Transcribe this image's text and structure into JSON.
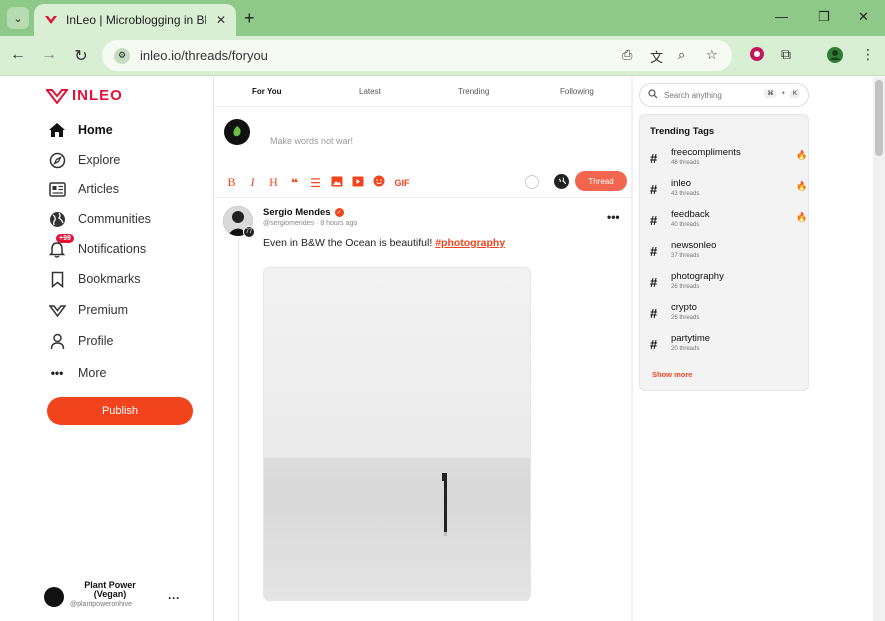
{
  "browser": {
    "tab_title": "InLeo | Microblogging in Blockc",
    "url": "inleo.io/threads/foryou",
    "accent": "#8fc98a"
  },
  "sidebar": {
    "logo_text": "INLEO",
    "items": [
      {
        "label": "Home",
        "icon": "home-icon",
        "active": true
      },
      {
        "label": "Explore",
        "icon": "compass-icon"
      },
      {
        "label": "Articles",
        "icon": "articles-icon"
      },
      {
        "label": "Communities",
        "icon": "globe-icon"
      },
      {
        "label": "Notifications",
        "icon": "bell-icon",
        "badge": "+99"
      },
      {
        "label": "Bookmarks",
        "icon": "bookmark-icon"
      },
      {
        "label": "Premium",
        "icon": "leo-icon"
      },
      {
        "label": "Profile",
        "icon": "user-icon"
      },
      {
        "label": "More",
        "icon": "dots-icon"
      }
    ],
    "publish_label": "Publish",
    "profile": {
      "name": "Plant Power (Vegan)",
      "handle": "@plantpoweronhive"
    }
  },
  "feed": {
    "tabs": [
      "For You",
      "Latest",
      "Trending",
      "Following"
    ],
    "composer_placeholder": "Make words not war!",
    "gif_label": "GIF",
    "thread_button": "Thread",
    "post": {
      "author": "Sergio Mendes",
      "handle": "@sergiomendes",
      "time": "8 hours ago",
      "level": "77",
      "text": "Even in B&W the Ocean is beautiful!",
      "hashtag": "#photography"
    }
  },
  "right": {
    "search_placeholder": "Search anything",
    "shortcut": [
      "⌘",
      "+",
      "K"
    ],
    "trending_title": "Trending Tags",
    "tags": [
      {
        "name": "freecompliments",
        "count": "48 threads",
        "hot": true
      },
      {
        "name": "inleo",
        "count": "43 threads",
        "hot": true
      },
      {
        "name": "feedback",
        "count": "40 threads",
        "hot": true
      },
      {
        "name": "newsonleo",
        "count": "37 threads",
        "hot": false
      },
      {
        "name": "photography",
        "count": "26 threads",
        "hot": false
      },
      {
        "name": "crypto",
        "count": "26 threads",
        "hot": false
      },
      {
        "name": "partytime",
        "count": "20 threads",
        "hot": false
      }
    ],
    "show_more": "Show more"
  }
}
